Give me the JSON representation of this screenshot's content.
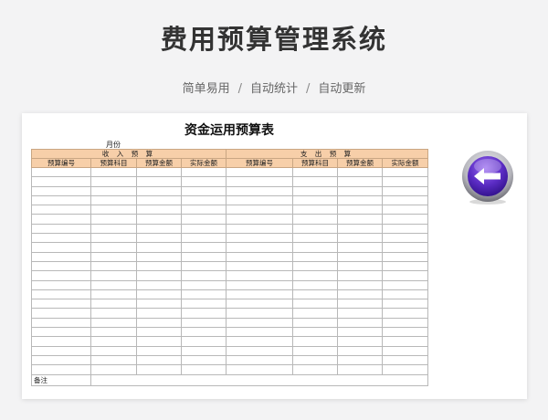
{
  "header": {
    "title": "费用预算管理系统",
    "features": [
      "简单易用",
      "自动统计",
      "自动更新"
    ],
    "separator": "/"
  },
  "sheet": {
    "title": "资金运用预算表",
    "month_label": "月份",
    "income_header": "收 入 预 算",
    "expense_header": "支 出 预 算",
    "income_columns": [
      "预算编号",
      "预算科目",
      "预算金额",
      "实际金额"
    ],
    "expense_columns": [
      "预算编号",
      "预算科目",
      "预算金额",
      "实际金额"
    ],
    "body_rows": 22,
    "note_label": "备注"
  },
  "nav": {
    "icon": "arrow-left-icon",
    "colors": {
      "ring": "#b8b8c0",
      "fill": "#5b2cc4",
      "arrow": "#ffffff"
    }
  }
}
